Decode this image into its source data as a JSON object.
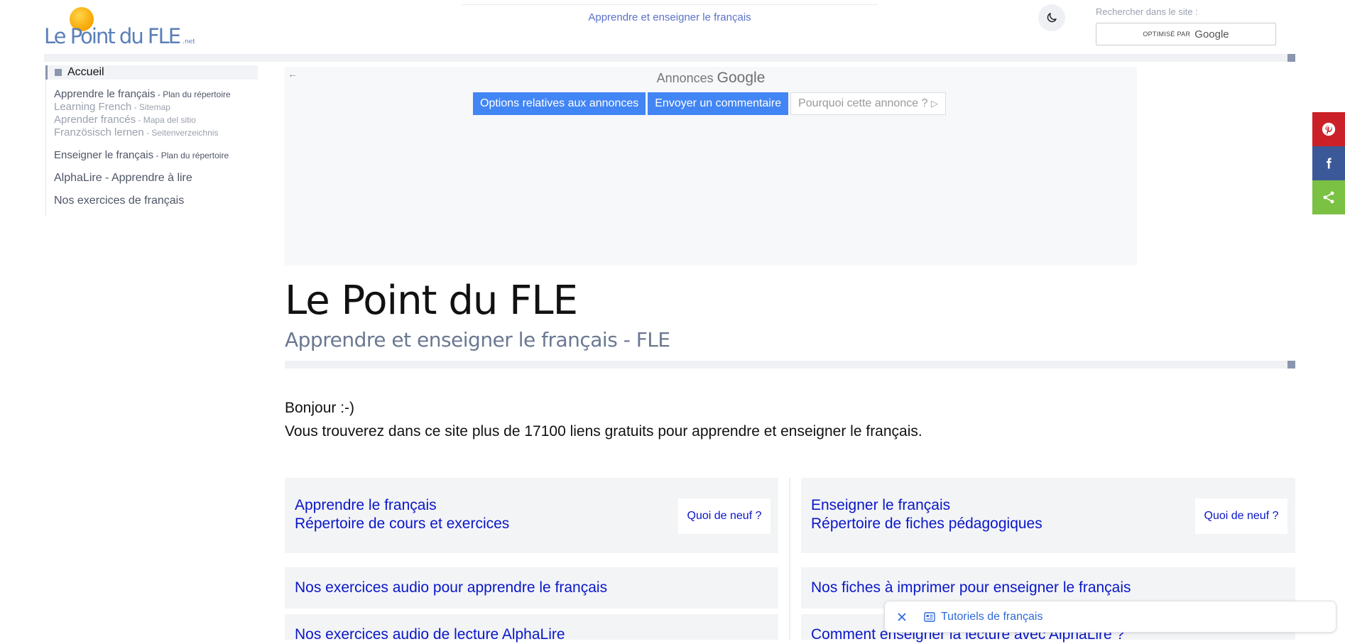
{
  "header": {
    "logo": {
      "text": "Le Point du FLE",
      "suffix": ".net"
    },
    "tagline": "Apprendre et enseigner le français",
    "search": {
      "label": "Rechercher dans le site :",
      "optimized_by": "OPTIMISÉ PAR",
      "provider": "Google"
    }
  },
  "sidebar": {
    "home": "Accueil",
    "groups": [
      [
        {
          "main": "Apprendre le français",
          "sub": " - Plan du répertoire",
          "light": false
        },
        {
          "main": "Learning French",
          "sub": " - Sitemap",
          "light": true
        },
        {
          "main": "Aprender francés",
          "sub": " - Mapa del sitio",
          "light": true
        },
        {
          "main": "Französisch lernen",
          "sub": " - Seitenverzeichnis",
          "light": true
        }
      ]
    ],
    "teach": {
      "main": "Enseigner le français",
      "sub": " - Plan du répertoire"
    },
    "alphalire": "AlphaLire - Apprendre à lire",
    "exercises": "Nos exercices de français"
  },
  "ad": {
    "label": "Annonces",
    "brand": "Google",
    "back_icon": "←",
    "buttons": {
      "options": "Options relatives aux annonces",
      "feedback": "Envoyer un commentaire",
      "why": "Pourquoi cette annonce ?",
      "why_icon": "▷"
    }
  },
  "main": {
    "title": "Le Point du FLE",
    "subtitle": "Apprendre et enseigner le français - FLE",
    "greeting": "Bonjour :-)",
    "intro": "Vous trouverez dans ce site plus de 17100 liens gratuits pour apprendre et enseigner le français."
  },
  "cards": {
    "learn": {
      "line1": "Apprendre le français",
      "line2": "Répertoire de cours et exercices",
      "news": "Quoi de neuf ?"
    },
    "teach": {
      "line1": "Enseigner le français",
      "line2": "Répertoire de fiches pédagogiques",
      "news": "Quoi de neuf ?"
    },
    "audio_learn": "Nos exercices audio pour apprendre le français",
    "print_teach": "Nos fiches à imprimer pour enseigner le français",
    "audio_alphalire": "Nos exercices audio de lecture AlphaLire",
    "teach_alphalire": "Comment enseigner la lecture avec AlphaLire ?"
  },
  "toast": {
    "label": "Tutoriels de français"
  },
  "colors": {
    "link": "#0a17c8",
    "accent": "#8a96ad",
    "ad_blue": "#4285f4",
    "pinterest": "#cb2027",
    "facebook": "#3b5998",
    "share": "#7bc144"
  }
}
